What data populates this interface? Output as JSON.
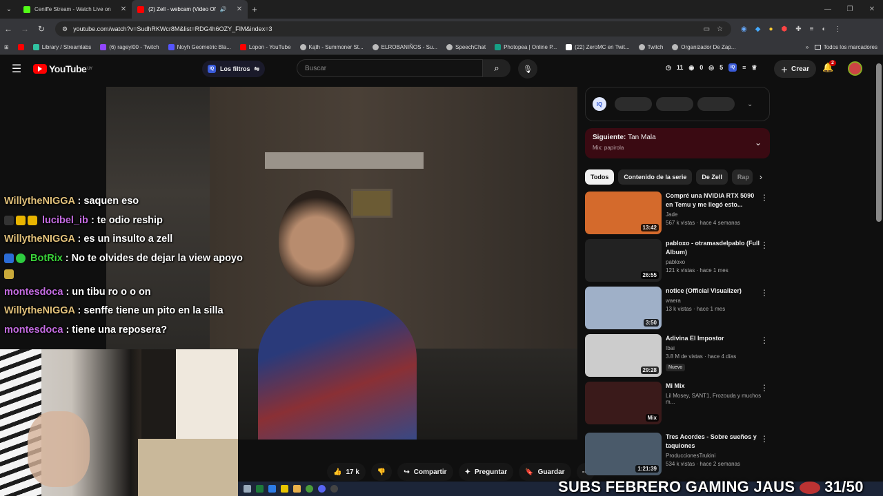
{
  "browser": {
    "tabs": [
      {
        "label": "Ceniffe Stream - Watch Live on",
        "active": false
      },
      {
        "label": "(2) Zell - webcam (Video Of",
        "active": true
      }
    ],
    "url": "youtube.com/watch?v=SudhRKWcr8M&list=RDG4h6OZY_FIM&index=3",
    "bookmarks": [
      "Library / Streamlabs",
      "(6) rageyl00 - Twitch",
      "Noyh Geometric Bla...",
      "Lopon - YouTube",
      "Kąth - Summoner St...",
      "ELROBANIÑOS - Su...",
      "SpeechChat",
      "Photopea | Online P...",
      "(22) ZeroMC en Twit...",
      "Twitch",
      "Organizador De Zap..."
    ],
    "bookmarks_all": "Todos los marcadores"
  },
  "header": {
    "logo_text": "YouTube",
    "region": "UY",
    "filters_label": "Los filtros",
    "search_placeholder": "Buscar",
    "stats": [
      "11",
      "0",
      "5"
    ],
    "create_label": "Crear",
    "notif_count": "2"
  },
  "chat": [
    {
      "user": "WillytheNIGGA",
      "msg": ": saquen eso",
      "color": "u1"
    },
    {
      "user": "lucibel_ib",
      "msg": ": te odio reship",
      "color": "u2"
    },
    {
      "user": "WillytheNIGGA",
      "msg": ": es un insulto a zell",
      "color": "u1"
    },
    {
      "user": "BotRix",
      "msg": ": No te olvides de dejar la view apoyo",
      "color": "u3"
    },
    {
      "user": "montesdoca",
      "msg": ": un tibu ro o o on",
      "color": "u2"
    },
    {
      "user": "WillytheNIGGA",
      "msg": ": senffe tiene un pito en la silla",
      "color": "u1"
    },
    {
      "user": "montesdoca",
      "msg": ": tiene una reposera?",
      "color": "u2"
    }
  ],
  "actions": {
    "likes": "17 k",
    "share": "Compartir",
    "ask": "Preguntar",
    "save": "Guardar"
  },
  "sidebar": {
    "next_label": "Siguiente:",
    "next_title": "Tan Mala",
    "next_mix": "Mix: papirola",
    "chips": [
      "Todos",
      "Contenido de la serie",
      "De Zell",
      "Rap"
    ],
    "videos": [
      {
        "title": "Compré una NVIDIA RTX 5090 en Temu y me llegó esto...",
        "channel": "Jade",
        "views": "567 k vistas · hace 4 semanas",
        "duration": "13:42",
        "bg": "#d46a2c"
      },
      {
        "title": "pabloxo - otramasdelpablo (Full Album)",
        "channel": "pabloxo",
        "views": "121 k vistas · hace 1 mes",
        "duration": "26:55",
        "bg": "#222"
      },
      {
        "title": "notice (Official Visualizer)",
        "channel": "waera",
        "views": "13 k vistas · hace 1 mes",
        "duration": "3:50",
        "bg": "#9fb0c8"
      },
      {
        "title": "Adivina El Impostor",
        "channel": "Ibai",
        "views": "3.8 M de vistas · hace 4 días",
        "duration": "29:28",
        "bg": "#ccc",
        "badge": "Nuevo"
      },
      {
        "title": "Mi Mix",
        "channel": "Lil Mosey, SANT1, Frozouda y muchos m...",
        "views": "",
        "duration": "Mix",
        "bg": "#3a1a1a"
      },
      {
        "title": "Tres Acordes - Sobre sueños y taquiones",
        "channel": "ProduccionesTrukini",
        "views": "534 k vistas · hace 2 semanas",
        "duration": "1:21:39",
        "bg": "#4a5a6a"
      }
    ]
  },
  "overlay": {
    "subs_text": "SUBS FEBRERO GAMING JAUS",
    "subs_count": "31/50"
  }
}
